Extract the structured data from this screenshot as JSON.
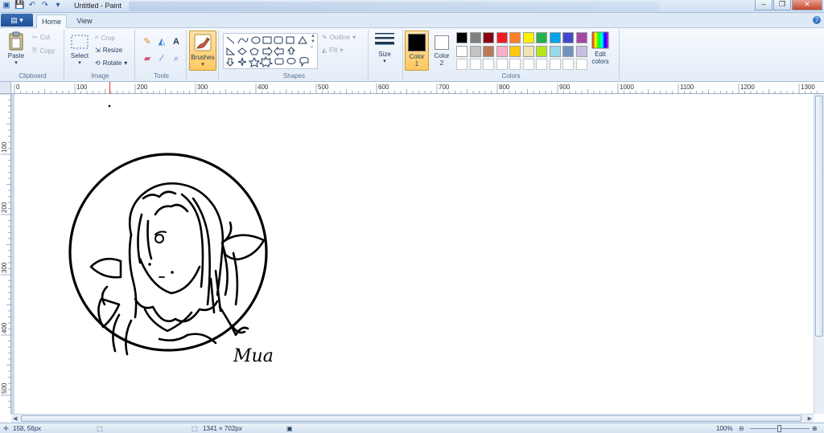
{
  "window": {
    "title": "Untitled - Paint",
    "controls": {
      "minimize": "–",
      "maximize": "❐",
      "close": "✕"
    }
  },
  "tabs": {
    "file_menu": "▤ ▾",
    "home": "Home",
    "view": "View"
  },
  "ribbon": {
    "clipboard": {
      "label": "Clipboard",
      "paste": "Paste",
      "cut": "Cut",
      "copy": "Copy"
    },
    "image": {
      "label": "Image",
      "select": "Select",
      "crop": "Crop",
      "resize": "Resize",
      "rotate": "Rotate"
    },
    "tools": {
      "label": "Tools"
    },
    "brushes": {
      "label": "Brushes"
    },
    "shapes": {
      "label": "Shapes",
      "outline": "Outline",
      "fill": "Fill"
    },
    "size": {
      "label": "Size"
    },
    "colors": {
      "label": "Colors",
      "color1": {
        "label": "Color",
        "num": "1",
        "value": "#000000"
      },
      "color2": {
        "label": "Color",
        "num": "2",
        "value": "#ffffff"
      },
      "edit": {
        "line1": "Edit",
        "line2": "colors"
      },
      "palette_row1": [
        "#000000",
        "#7f7f7f",
        "#880015",
        "#ed1c24",
        "#ff7f27",
        "#fff200",
        "#22b14c",
        "#00a2e8",
        "#3f48cc",
        "#a349a4"
      ],
      "palette_row2": [
        "#ffffff",
        "#c3c3c3",
        "#b97a57",
        "#ffaec9",
        "#ffc90e",
        "#efe4b0",
        "#b5e61d",
        "#99d9ea",
        "#7092be",
        "#c8bfe7"
      ]
    }
  },
  "rulers": {
    "top": [
      "0",
      "100",
      "200",
      "300",
      "400",
      "500",
      "600",
      "700",
      "800",
      "900",
      "1000",
      "1100",
      "1200",
      "1300"
    ],
    "left": [
      "100",
      "200",
      "300",
      "400",
      "500"
    ]
  },
  "drawing": {
    "signature": "Mua"
  },
  "status": {
    "cursor": "158, 56px",
    "image_size": "1341 × 702px",
    "zoom": "100%"
  }
}
